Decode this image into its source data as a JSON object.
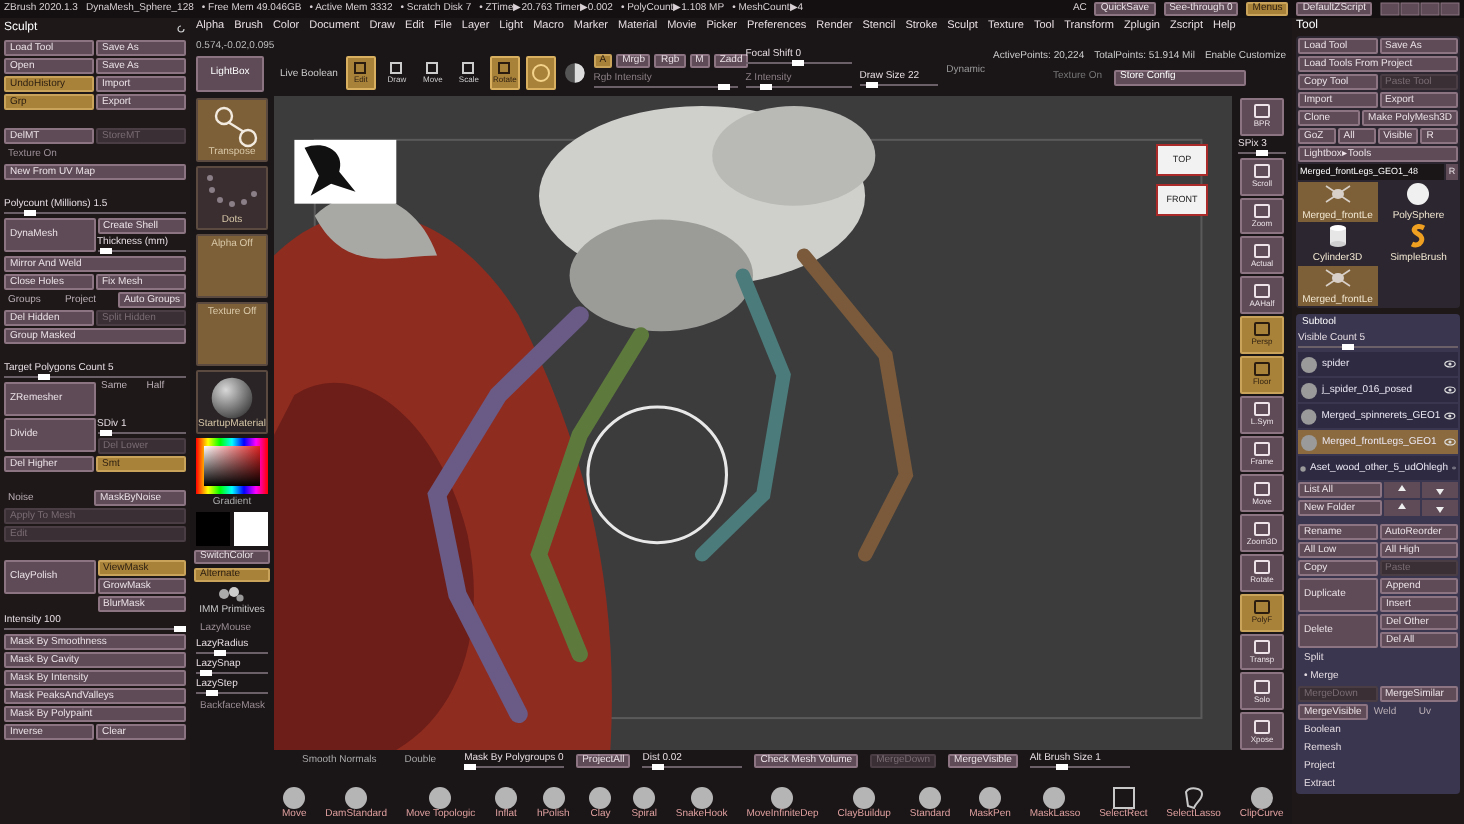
{
  "title_bar": {
    "app": "ZBrush 2020.1.3",
    "document": "DynaMesh_Sphere_128",
    "stats": [
      "• Free Mem 49.046GB",
      "• Active Mem 3332",
      "• Scratch Disk 7",
      "• ZTime▶20.763 Timer▶0.002",
      "• PolyCount▶1.108 MP",
      "• MeshCount▶4"
    ],
    "ac": "AC",
    "buttons": [
      {
        "label": "QuickSave",
        "on": false,
        "disabled": false
      },
      {
        "label": "See-through 0",
        "on": false,
        "disabled": false
      },
      {
        "label": "Menus",
        "on": true,
        "disabled": false
      },
      {
        "label": "DefaultZScript",
        "on": false,
        "disabled": false
      }
    ]
  },
  "menu": [
    "Alpha",
    "Brush",
    "Color",
    "Document",
    "Draw",
    "Edit",
    "File",
    "Layer",
    "Light",
    "Macro",
    "Marker",
    "Material",
    "Movie",
    "Picker",
    "Preferences",
    "Render",
    "Stencil",
    "Stroke",
    "Sculpt",
    "Texture",
    "Tool",
    "Transform",
    "Zplugin",
    "Zscript",
    "Help"
  ],
  "left_palette": {
    "title": "Sculpt",
    "groups": [
      [
        {
          "kind": "buttons",
          "buttons": [
            {
              "label": "Load Tool",
              "on": false,
              "disabled": false
            },
            {
              "label": "Save As",
              "on": false,
              "disabled": false
            }
          ]
        },
        {
          "kind": "buttons",
          "buttons": [
            {
              "label": "Open",
              "on": false,
              "disabled": false
            },
            {
              "label": "Save As",
              "on": false,
              "disabled": false
            }
          ]
        },
        {
          "kind": "buttons",
          "buttons": [
            {
              "label": "UndoHistory",
              "on": true,
              "disabled": false
            },
            {
              "label": "Import",
              "on": false,
              "disabled": false
            }
          ]
        },
        {
          "kind": "buttons",
          "buttons": [
            {
              "label": "Grp",
              "on": true,
              "disabled": false
            },
            {
              "label": "Export",
              "on": false,
              "disabled": false
            }
          ]
        }
      ],
      [
        {
          "kind": "buttons",
          "buttons": [
            {
              "label": "DelMT",
              "on": false,
              "disabled": false
            },
            {
              "label": "StoreMT",
              "on": false,
              "disabled": true
            }
          ]
        },
        {
          "kind": "label",
          "text": "Texture On"
        },
        {
          "kind": "buttons",
          "buttons": [
            {
              "label": "New From UV Map",
              "on": false,
              "disabled": false
            }
          ]
        }
      ],
      [
        {
          "kind": "slider",
          "label": "Polycount (Millions) 1.5",
          "level": 0.12
        },
        {
          "kind": "split",
          "main": {
            "label": "DynaMesh",
            "on": false,
            "disabled": false
          },
          "side": [
            {
              "kind": "buttons",
              "buttons": [
                {
                  "label": "Create Shell",
                  "on": false,
                  "disabled": false
                }
              ]
            },
            {
              "kind": "slider",
              "label": "Thickness (mm)",
              "level": 0.05
            }
          ]
        },
        {
          "kind": "buttons",
          "buttons": [
            {
              "label": "Mirror And Weld",
              "on": false,
              "disabled": false
            }
          ]
        },
        {
          "kind": "buttons",
          "buttons": [
            {
              "label": "Close Holes",
              "on": false,
              "disabled": false
            },
            {
              "label": "Fix Mesh",
              "on": false,
              "disabled": false
            }
          ]
        },
        {
          "kind": "buttons",
          "buttons": [
            {
              "kind": "text",
              "label": "Groups"
            },
            {
              "kind": "text",
              "label": "Project"
            },
            {
              "kind": "button",
              "label": "Auto Groups",
              "on": false,
              "disabled": false
            }
          ]
        },
        {
          "kind": "buttons",
          "buttons": [
            {
              "label": "Del Hidden",
              "on": false,
              "disabled": false
            },
            {
              "label": "Split Hidden",
              "on": false,
              "disabled": true
            }
          ]
        },
        {
          "kind": "buttons",
          "buttons": [
            {
              "label": "Group Masked",
              "on": false,
              "disabled": false
            }
          ]
        }
      ],
      [
        {
          "kind": "slider",
          "label": "Target Polygons Count 5",
          "level": 0.2
        },
        {
          "kind": "split",
          "main": {
            "label": "ZRemesher",
            "on": false,
            "disabled": false
          },
          "side": [
            {
              "kind": "buttons",
              "buttons": [
                {
                  "kind": "text",
                  "label": "Same"
                },
                {
                  "kind": "text",
                  "label": "Half"
                }
              ]
            }
          ]
        },
        {
          "kind": "split",
          "main": {
            "label": "Divide",
            "on": false,
            "disabled": false
          },
          "side": [
            {
              "kind": "slider",
              "label": "SDiv 1",
              "level": 0.05
            },
            {
              "kind": "buttons",
              "buttons": [
                {
                  "label": "Del Lower",
                  "on": false,
                  "disabled": true
                }
              ]
            }
          ]
        },
        {
          "kind": "buttons",
          "buttons": [
            {
              "label": "Del Higher",
              "on": false,
              "disabled": false
            },
            {
              "label": "Smt",
              "on": true,
              "disabled": false
            }
          ]
        }
      ],
      [
        {
          "kind": "buttons",
          "buttons": [
            {
              "kind": "text",
              "label": "Noise"
            },
            {
              "kind": "button",
              "label": "MaskByNoise",
              "on": false,
              "disabled": false
            }
          ]
        },
        {
          "kind": "buttons",
          "buttons": [
            {
              "label": "Apply To Mesh",
              "on": false,
              "disabled": true
            }
          ]
        },
        {
          "kind": "buttons",
          "buttons": [
            {
              "label": "Edit",
              "on": false,
              "disabled": true
            }
          ]
        }
      ],
      [
        {
          "kind": "split",
          "main": {
            "label": "ClayPolish",
            "on": false,
            "disabled": false
          },
          "side": [
            {
              "kind": "buttons",
              "buttons": [
                {
                  "label": "ViewMask",
                  "on": true,
                  "disabled": false
                }
              ]
            },
            {
              "kind": "buttons",
              "buttons": [
                {
                  "label": "GrowMask",
                  "on": false,
                  "disabled": false
                }
              ]
            },
            {
              "kind": "buttons",
              "buttons": [
                {
                  "label": "BlurMask",
                  "on": false,
                  "disabled": false
                }
              ]
            }
          ]
        },
        {
          "kind": "slider",
          "label": "Intensity 100",
          "level": 1
        },
        {
          "kind": "buttons",
          "buttons": [
            {
              "label": "Mask By Smoothness",
              "on": false,
              "disabled": false
            }
          ]
        },
        {
          "kind": "buttons",
          "buttons": [
            {
              "label": "Mask By Cavity",
              "on": false,
              "disabled": false
            }
          ]
        },
        {
          "kind": "buttons",
          "buttons": [
            {
              "label": "Mask By Intensity",
              "on": false,
              "disabled": false
            }
          ]
        },
        {
          "kind": "buttons",
          "buttons": [
            {
              "label": "Mask PeaksAndValleys",
              "on": false,
              "disabled": false
            }
          ]
        },
        {
          "kind": "buttons",
          "buttons": [
            {
              "label": "Mask By Polypaint",
              "on": false,
              "disabled": false
            }
          ]
        },
        {
          "kind": "buttons",
          "buttons": [
            {
              "label": "Inverse",
              "on": false,
              "disabled": false
            },
            {
              "label": "Clear",
              "on": false,
              "disabled": false
            }
          ]
        }
      ]
    ]
  },
  "toolbar": {
    "coords": "0.574,-0.02,0.095",
    "lightbox": "LightBox",
    "live_boolean": "Live Boolean",
    "modes": [
      {
        "kind": "labeled",
        "label": "Edit",
        "on": true
      },
      {
        "kind": "labeled",
        "label": "Draw",
        "on": false
      },
      {
        "kind": "labeled",
        "label": "Move",
        "on": false
      },
      {
        "kind": "labeled",
        "label": "Scale",
        "on": false
      },
      {
        "kind": "labeled",
        "label": "Rotate",
        "on": true
      },
      {
        "kind": "icon",
        "on": true
      }
    ],
    "channels": [
      {
        "label": "A",
        "on": true,
        "disabled": false
      },
      {
        "label": "Mrgb",
        "on": false,
        "disabled": false
      },
      {
        "label": "Rgb",
        "on": false,
        "disabled": false
      },
      {
        "label": "M",
        "on": false,
        "disabled": false
      },
      {
        "label": "Zadd",
        "on": false,
        "disabled": false
      }
    ],
    "rgb_intensity": {
      "label": "Rgb Intensity",
      "level": 0.95
    },
    "focal_shift": {
      "label": "Focal Shift 0",
      "level": 0.5
    },
    "z_intensity": {
      "label": "Z Intensity",
      "level": 0.15
    },
    "draw_size": {
      "label": "Draw Size 22",
      "level": 0.1
    },
    "dynamic": "Dynamic",
    "active_points": "ActivePoints: 20,224",
    "total_points": "TotalPoints: 51.914 Mil",
    "enable_customize": "Enable Customize",
    "texture_on": "Texture On",
    "store_config": "Store Config"
  },
  "tool_column": {
    "tiles": [
      {
        "label": "Transpose",
        "kind": "transpose"
      },
      {
        "label": "Dots",
        "kind": "dots"
      },
      {
        "label": "Alpha Off",
        "kind": "empty"
      },
      {
        "label": "Texture Off",
        "kind": "empty"
      },
      {
        "label": "StartupMaterial",
        "kind": "material"
      }
    ],
    "gradient": "Gradient",
    "buttons": [
      {
        "label": "SwitchColor",
        "on": false,
        "disabled": false
      },
      {
        "label": "Alternate",
        "on": true,
        "disabled": false
      }
    ],
    "primitives": "IMM Primitives",
    "lazy": [
      {
        "kind": "label",
        "text": "LazyMouse"
      },
      {
        "kind": "slider",
        "label": "LazyRadius",
        "level": 0.3
      },
      {
        "kind": "slider",
        "label": "LazySnap",
        "level": 0.05
      },
      {
        "kind": "slider",
        "label": "LazyStep",
        "level": 0.15
      },
      {
        "kind": "label",
        "text": "BackfaceMask"
      }
    ]
  },
  "nav_cube": [
    "TOP",
    "FRONT"
  ],
  "view_controls": [
    {
      "kind": "button",
      "label": "BPR",
      "on": false
    },
    {
      "kind": "slider",
      "label": "SPix 3",
      "level": 0.5
    },
    {
      "kind": "button",
      "label": "Scroll",
      "on": false
    },
    {
      "kind": "button",
      "label": "Zoom",
      "on": false
    },
    {
      "kind": "button",
      "label": "Actual",
      "on": false
    },
    {
      "kind": "button",
      "label": "AAHalf",
      "on": false
    },
    {
      "kind": "button",
      "label": "Persp",
      "on": true
    },
    {
      "kind": "button",
      "label": "Floor",
      "on": true
    },
    {
      "kind": "button",
      "label": "L.Sym",
      "on": false
    },
    {
      "kind": "button",
      "label": "Frame",
      "on": false
    },
    {
      "kind": "button",
      "label": "Move",
      "on": false
    },
    {
      "kind": "button",
      "label": "Zoom3D",
      "on": false
    },
    {
      "kind": "button",
      "label": "Rotate",
      "on": false
    },
    {
      "kind": "button",
      "label": "PolyF",
      "on": true
    },
    {
      "kind": "button",
      "label": "Transp",
      "on": false
    },
    {
      "kind": "button",
      "label": "Solo",
      "on": false
    },
    {
      "kind": "button",
      "label": "Xpose",
      "on": false
    }
  ],
  "tool_palette": {
    "title": "Tool",
    "rows": [
      {
        "kind": "buttons",
        "buttons": [
          {
            "label": "Load Tool",
            "on": false,
            "disabled": false
          },
          {
            "label": "Save As",
            "on": false,
            "disabled": false
          }
        ]
      },
      {
        "kind": "buttons",
        "buttons": [
          {
            "label": "Load Tools From Project",
            "on": false,
            "disabled": false
          }
        ]
      },
      {
        "kind": "buttons",
        "buttons": [
          {
            "label": "Copy Tool",
            "on": false,
            "disabled": false
          },
          {
            "label": "Paste Tool",
            "on": false,
            "disabled": true
          }
        ]
      },
      {
        "kind": "buttons",
        "buttons": [
          {
            "label": "Import",
            "on": false,
            "disabled": false
          },
          {
            "label": "Export",
            "on": false,
            "disabled": false
          }
        ]
      },
      {
        "kind": "buttons",
        "buttons": [
          {
            "label": "Clone",
            "on": false,
            "disabled": false
          },
          {
            "label": "Make PolyMesh3D",
            "on": false,
            "disabled": false
          }
        ]
      },
      {
        "kind": "buttons",
        "buttons": [
          {
            "label": "GoZ",
            "on": false,
            "disabled": false
          },
          {
            "label": "All",
            "on": false,
            "disabled": false
          },
          {
            "label": "Visible",
            "on": false,
            "disabled": false
          },
          {
            "label": "R",
            "on": false,
            "disabled": false
          }
        ]
      },
      {
        "kind": "buttons",
        "buttons": [
          {
            "label": "Lightbox▸Tools",
            "on": false,
            "disabled": false
          }
        ]
      }
    ],
    "current": "Merged_frontLegs_GEO1_48",
    "current_r": "R",
    "thumbnails": [
      {
        "label": "Merged_frontLe",
        "kind": "spider"
      },
      {
        "label": "PolySphere",
        "kind": "sphere"
      },
      {
        "label": "Cylinder3D",
        "kind": "cylinder"
      },
      {
        "label": "SimpleBrush",
        "kind": "brush"
      },
      {
        "label": "Merged_frontLe",
        "kind": "spider"
      }
    ]
  },
  "subtool": {
    "title": "Subtool",
    "visible_count": {
      "label": "Visible Count 5",
      "level": 0.3
    },
    "items": [
      {
        "name": "spider",
        "selected": false,
        "visible": true
      },
      {
        "name": "j_spider_016_posed",
        "selected": false,
        "visible": true
      },
      {
        "name": "Merged_spinnerets_GEO1",
        "selected": false,
        "visible": true
      },
      {
        "name": "Merged_frontLegs_GEO1",
        "selected": true,
        "visible": true
      },
      {
        "name": "Aset_wood_other_5_udOhlegh",
        "selected": false,
        "visible": true
      }
    ],
    "list_buttons": [
      {
        "label": "List All",
        "on": false,
        "disabled": false
      },
      {
        "label": "New Folder",
        "on": false,
        "disabled": false
      }
    ],
    "rows": [
      {
        "kind": "buttons",
        "buttons": [
          {
            "label": "Rename",
            "on": false,
            "disabled": false
          },
          {
            "label": "AutoReorder",
            "on": false,
            "disabled": false
          }
        ]
      },
      {
        "kind": "buttons",
        "buttons": [
          {
            "label": "All Low",
            "on": false,
            "disabled": false
          },
          {
            "label": "All High",
            "on": false,
            "disabled": false
          }
        ]
      },
      {
        "kind": "buttons",
        "buttons": [
          {
            "label": "Copy",
            "on": false,
            "disabled": false
          },
          {
            "label": "Paste",
            "on": false,
            "disabled": true
          }
        ]
      },
      {
        "kind": "split",
        "main": {
          "label": "Duplicate",
          "on": false,
          "disabled": false
        },
        "side": [
          {
            "kind": "buttons",
            "buttons": [
              {
                "label": "Append",
                "on": false,
                "disabled": false
              }
            ]
          },
          {
            "kind": "buttons",
            "buttons": [
              {
                "label": "Insert",
                "on": false,
                "disabled": false
              }
            ]
          }
        ]
      },
      {
        "kind": "split",
        "main": {
          "label": "Delete",
          "on": false,
          "disabled": false
        },
        "side": [
          {
            "kind": "buttons",
            "buttons": [
              {
                "label": "Del Other",
                "on": false,
                "disabled": false
              }
            ]
          },
          {
            "kind": "buttons",
            "buttons": [
              {
                "label": "Del All",
                "on": false,
                "disabled": false
              }
            ]
          }
        ]
      },
      {
        "kind": "section",
        "text": "Split"
      },
      {
        "kind": "section",
        "text": "• Merge"
      },
      {
        "kind": "buttons",
        "buttons": [
          {
            "label": "MergeDown",
            "on": false,
            "disabled": true
          },
          {
            "label": "MergeSimilar",
            "on": false,
            "disabled": false
          }
        ]
      },
      {
        "kind": "buttons",
        "buttons": [
          {
            "kind": "button",
            "label": "MergeVisible",
            "on": false,
            "disabled": false
          },
          {
            "kind": "text",
            "label": "Weld"
          },
          {
            "kind": "text",
            "label": "Uv"
          }
        ]
      },
      {
        "kind": "section",
        "text": "Boolean"
      },
      {
        "kind": "section",
        "text": "Remesh"
      },
      {
        "kind": "section",
        "text": "Project"
      },
      {
        "kind": "section",
        "text": "Extract"
      }
    ]
  },
  "bottom_bar": {
    "row": [
      {
        "kind": "text",
        "label": "Smooth Normals"
      },
      {
        "kind": "text",
        "label": "Double"
      },
      {
        "kind": "slider",
        "label": "Mask By Polygroups 0",
        "level": 0
      },
      {
        "kind": "button",
        "label": "ProjectAll",
        "on": false,
        "disabled": false
      },
      {
        "kind": "slider",
        "label": "Dist 0.02",
        "level": 0.1
      },
      {
        "kind": "button",
        "label": "Check Mesh Volume",
        "on": false,
        "disabled": false
      },
      {
        "kind": "button",
        "label": "MergeDown",
        "on": false,
        "disabled": true
      },
      {
        "kind": "button",
        "label": "MergeVisible",
        "on": false,
        "disabled": false
      },
      {
        "kind": "slider",
        "label": "Alt Brush Size 1",
        "level": 0.3
      }
    ],
    "brushes": [
      {
        "label": "Move",
        "kind": "sphere"
      },
      {
        "label": "DamStandard",
        "kind": "sphere"
      },
      {
        "label": "Move Topologic",
        "kind": "sphere"
      },
      {
        "label": "Inflat",
        "kind": "sphere"
      },
      {
        "label": "hPolish",
        "kind": "sphere"
      },
      {
        "label": "Clay",
        "kind": "sphere"
      },
      {
        "label": "Spiral",
        "kind": "sphere"
      },
      {
        "label": "SnakeHook",
        "kind": "sphere"
      },
      {
        "label": "MoveInfiniteDep",
        "kind": "sphere"
      },
      {
        "label": "ClayBuildup",
        "kind": "sphere"
      },
      {
        "label": "Standard",
        "kind": "sphere"
      },
      {
        "label": "MaskPen",
        "kind": "sphere"
      },
      {
        "label": "MaskLasso",
        "kind": "sphere"
      },
      {
        "label": "SelectRect",
        "kind": "rect"
      },
      {
        "label": "SelectLasso",
        "kind": "lasso"
      },
      {
        "label": "ClipCurve",
        "kind": "sphere"
      }
    ]
  }
}
